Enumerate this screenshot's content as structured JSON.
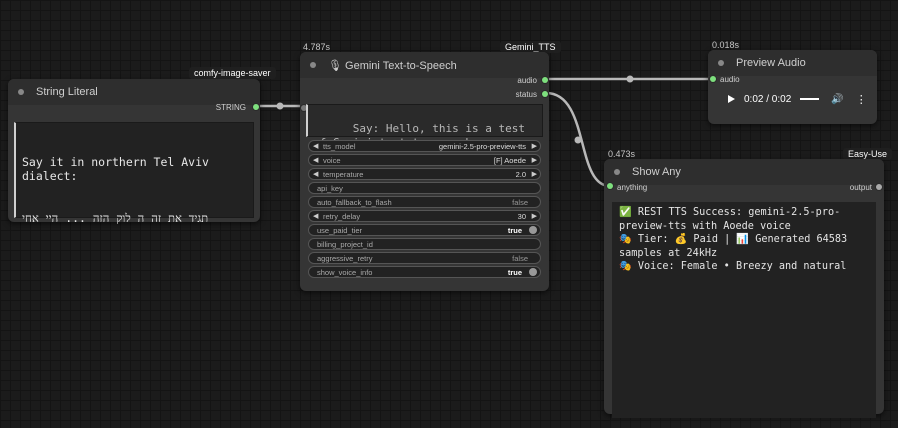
{
  "nodes": {
    "string_literal": {
      "title": "String Literal",
      "badge": "comfy-image-saver",
      "output_label": "STRING",
      "text_line1": "Say it in northern Tel Aviv dialect:",
      "text_line2": "תגיד את זה ה לוק הזה ... היי אחי"
    },
    "gemini_tts": {
      "title": "Gemini Text-to-Speech",
      "timing": "4.787s",
      "badge": "Gemini_TTS",
      "outputs": [
        "audio",
        "status"
      ],
      "text": "Say: Hello, this is a test of Gemini text-to-speech.",
      "widgets": [
        {
          "label": "tts_model",
          "value": "gemini-2.5-pro-preview-tts"
        },
        {
          "label": "voice",
          "value": "[F] Aoede"
        },
        {
          "label": "temperature",
          "value": "2.0"
        },
        {
          "label": "api_key",
          "value": ""
        },
        {
          "label": "auto_fallback_to_flash",
          "value": "false"
        },
        {
          "label": "retry_delay",
          "value": "30"
        },
        {
          "label": "use_paid_tier",
          "value": "true"
        },
        {
          "label": "billing_project_id",
          "value": ""
        },
        {
          "label": "aggressive_retry",
          "value": "false"
        },
        {
          "label": "show_voice_info",
          "value": "true"
        }
      ]
    },
    "preview_audio": {
      "title": "Preview Audio",
      "timing": "0.018s",
      "input_label": "audio",
      "time": "0:02 / 0:02"
    },
    "show_any": {
      "title": "Show Any",
      "timing": "0.473s",
      "badge": "Easy-Use",
      "input_label": "anything",
      "output_label": "output",
      "line1": "✅ REST TTS Success: gemini-2.5-pro-preview-tts with Aoede voice",
      "line2": "🎭 Tier: 💰 Paid | 📊 Generated 64583 samples at 24kHz",
      "line3": "🎭 Voice: Female • Breezy and natural"
    }
  },
  "colors": {
    "port_active": "#7ee07e",
    "link": "#b8b8b8",
    "node_bg": "#353535"
  }
}
